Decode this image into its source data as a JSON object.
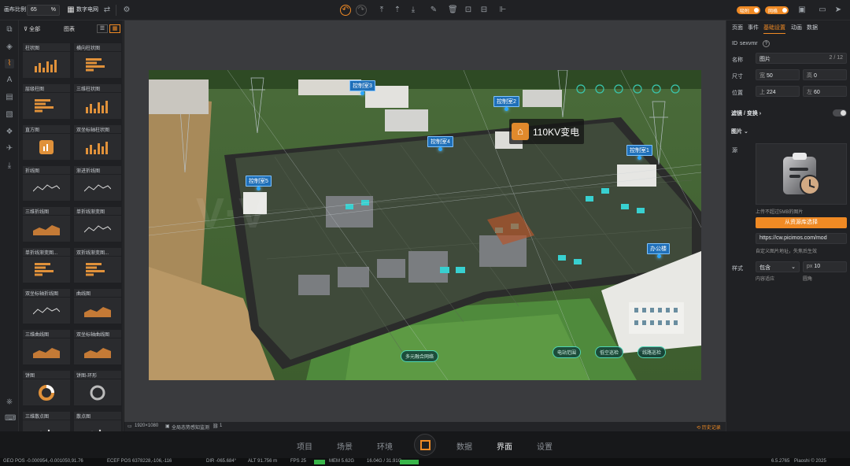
{
  "topbar": {
    "scale_label": "画布比例",
    "scale_value": "65",
    "scale_unit": "%",
    "digital_grid": "数字电网",
    "toggle_a": "吸附",
    "toggle_b": "网格"
  },
  "library": {
    "filter_all": "全部",
    "filter_chart": "图表",
    "items": [
      {
        "label": "柱状图"
      },
      {
        "label": "横向柱状图"
      },
      {
        "label": "层级柱图"
      },
      {
        "label": "三维柱状图"
      },
      {
        "label": "直方图"
      },
      {
        "label": "双坐标轴柱状图"
      },
      {
        "label": "折线图"
      },
      {
        "label": "渐进折线图"
      },
      {
        "label": "三维折线图"
      },
      {
        "label": "单折线渐变图"
      },
      {
        "label": "单折线渐变图..."
      },
      {
        "label": "双折线渐变图..."
      },
      {
        "label": "双坐标轴折线图"
      },
      {
        "label": "曲线图"
      },
      {
        "label": "三维曲线图"
      },
      {
        "label": "双坐标轴曲线图"
      },
      {
        "label": "饼图"
      },
      {
        "label": "饼图-环形"
      },
      {
        "label": "三维散点图"
      },
      {
        "label": "散点图"
      }
    ]
  },
  "scene": {
    "tags": {
      "room3": "控制室3",
      "room2": "控制室2",
      "room4": "控制室4",
      "room1": "控制室1",
      "room5": "控制室5",
      "office": "办公楼"
    },
    "title": "110KV变电",
    "pills": {
      "multi_view": "多元融合网络",
      "station_range": "电站范围",
      "low_patrol": "低空巡检",
      "line_patrol": "线路巡检"
    }
  },
  "canvas_status": {
    "resolution": "1920×1080",
    "scene_name": "全局态势感知监测",
    "count": "1",
    "history": "历史记录"
  },
  "bottom_tabs": [
    "项目",
    "场景",
    "环境",
    "数据",
    "界面",
    "设置"
  ],
  "bottom_status": {
    "geo_pos": "GEO POS  -0.000954,-0.001050,91.76",
    "ecef_pos": "ECEF POS  6378228,-106,-116",
    "dir": "DIR  -065.684°",
    "alt": "ALT  91.756 m",
    "fps": "FPS  25",
    "mem": "MEM  5.62G",
    "mem_detail": "16.04G / 31.91G",
    "version": "6.5.2765",
    "brand": "Piaoshi © 2025"
  },
  "rpanel": {
    "tabs": [
      "页面",
      "事件",
      "基础设置",
      "动画",
      "数据"
    ],
    "id_label": "ID",
    "id_value": "sexvmr",
    "name_label": "名称",
    "name_value": "图片",
    "name_count": "2 / 12",
    "size_label": "尺寸",
    "width_prefix": "宽",
    "width_value": "50",
    "height_prefix": "高",
    "height_value": "0",
    "pos_label": "位置",
    "top_prefix": "上",
    "top_value": "224",
    "left_prefix": "左",
    "left_value": "60",
    "filter_label": "滤镜 / 变换",
    "image_section": "图片",
    "source_label": "源",
    "upload_hint": "上传不超过5MB的图片",
    "choose_btn": "从资源库选择",
    "url_value": "https://cw.picimos.com/mod",
    "url_hint": "自定义图片地址，失焦后生效",
    "style_label": "样式",
    "style_value": "包含",
    "style_hint": "内容适应",
    "radius_unit": "px",
    "radius_value": "10",
    "radius_hint": "圆角"
  },
  "colors": {
    "accent": "#f08a24",
    "tag_blue": "#1f6fb8",
    "panel": "#202124"
  }
}
